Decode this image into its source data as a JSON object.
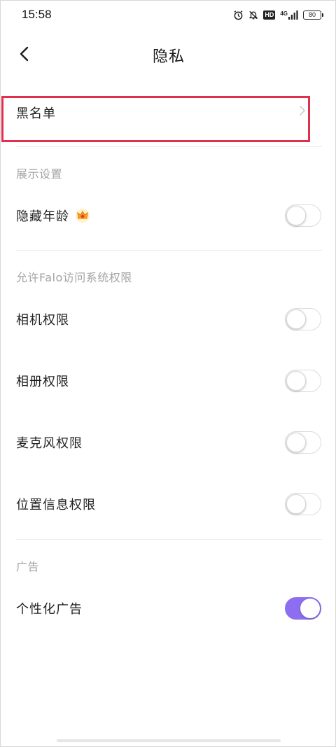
{
  "status": {
    "time": "15:58",
    "hd": "HD",
    "network": "4G",
    "battery": "80"
  },
  "header": {
    "title": "隐私"
  },
  "blacklist": {
    "label": "黑名单"
  },
  "display_section": {
    "title": "展示设置",
    "items": [
      {
        "label": "隐藏年龄",
        "enabled": false
      }
    ]
  },
  "permissions_section": {
    "title": "允许Falo访问系统权限",
    "items": [
      {
        "label": "相机权限",
        "enabled": false
      },
      {
        "label": "相册权限",
        "enabled": false
      },
      {
        "label": "麦克风权限",
        "enabled": false
      },
      {
        "label": "位置信息权限",
        "enabled": false
      }
    ]
  },
  "ads_section": {
    "title": "广告",
    "items": [
      {
        "label": "个性化广告",
        "enabled": true
      }
    ]
  },
  "colors": {
    "accent": "#8d6ef0",
    "highlight_border": "#e0304e",
    "section_title": "#a3a3a3"
  }
}
